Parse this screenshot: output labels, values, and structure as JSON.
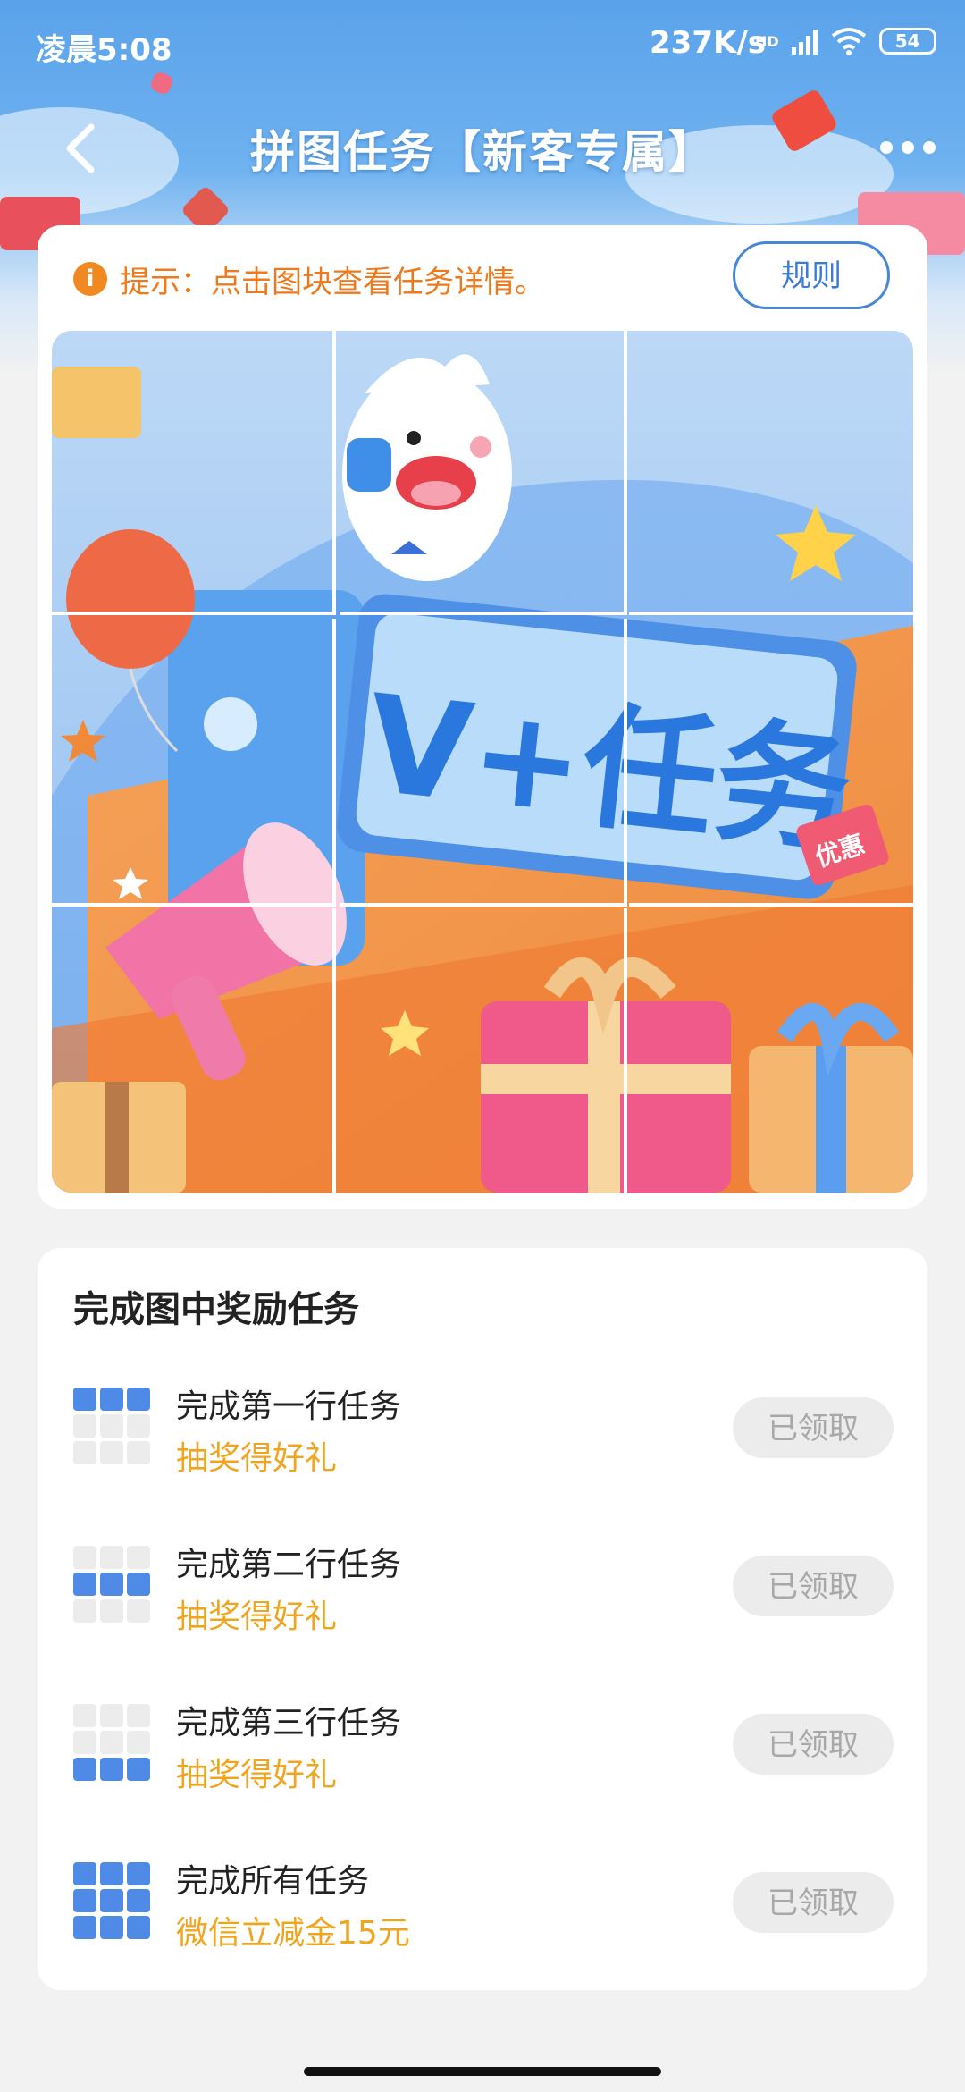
{
  "status_bar": {
    "time": "凌晨5:08",
    "speed": "237K/s",
    "network": "HD",
    "battery": "54"
  },
  "nav": {
    "title": "拼图任务【新客专属】",
    "back_icon": "chevron-left-icon",
    "more_icon": "more-dots-icon"
  },
  "puzzle": {
    "tip_icon": "info-icon",
    "tip": "提示：点击图块查看任务详情。",
    "rules_label": "规则",
    "art_text": "V+任务",
    "sticker_text": "优惠"
  },
  "rewards": {
    "title": "完成图中奖励任务",
    "items": [
      {
        "task": "完成第一行任务",
        "prize": "抽奖得好礼",
        "button": "已领取",
        "status": "claimed"
      },
      {
        "task": "完成第二行任务",
        "prize": "抽奖得好礼",
        "button": "已领取",
        "status": "claimed"
      },
      {
        "task": "完成第三行任务",
        "prize": "抽奖得好礼",
        "button": "已领取",
        "status": "claimed"
      },
      {
        "task": "完成所有任务",
        "prize": "微信立减金15元",
        "button": "已领取",
        "status": "claimed"
      }
    ]
  },
  "colors": {
    "accent_blue": "#4f8be6",
    "prize_orange": "#f0a51f",
    "tip_orange": "#ee7a1e"
  }
}
